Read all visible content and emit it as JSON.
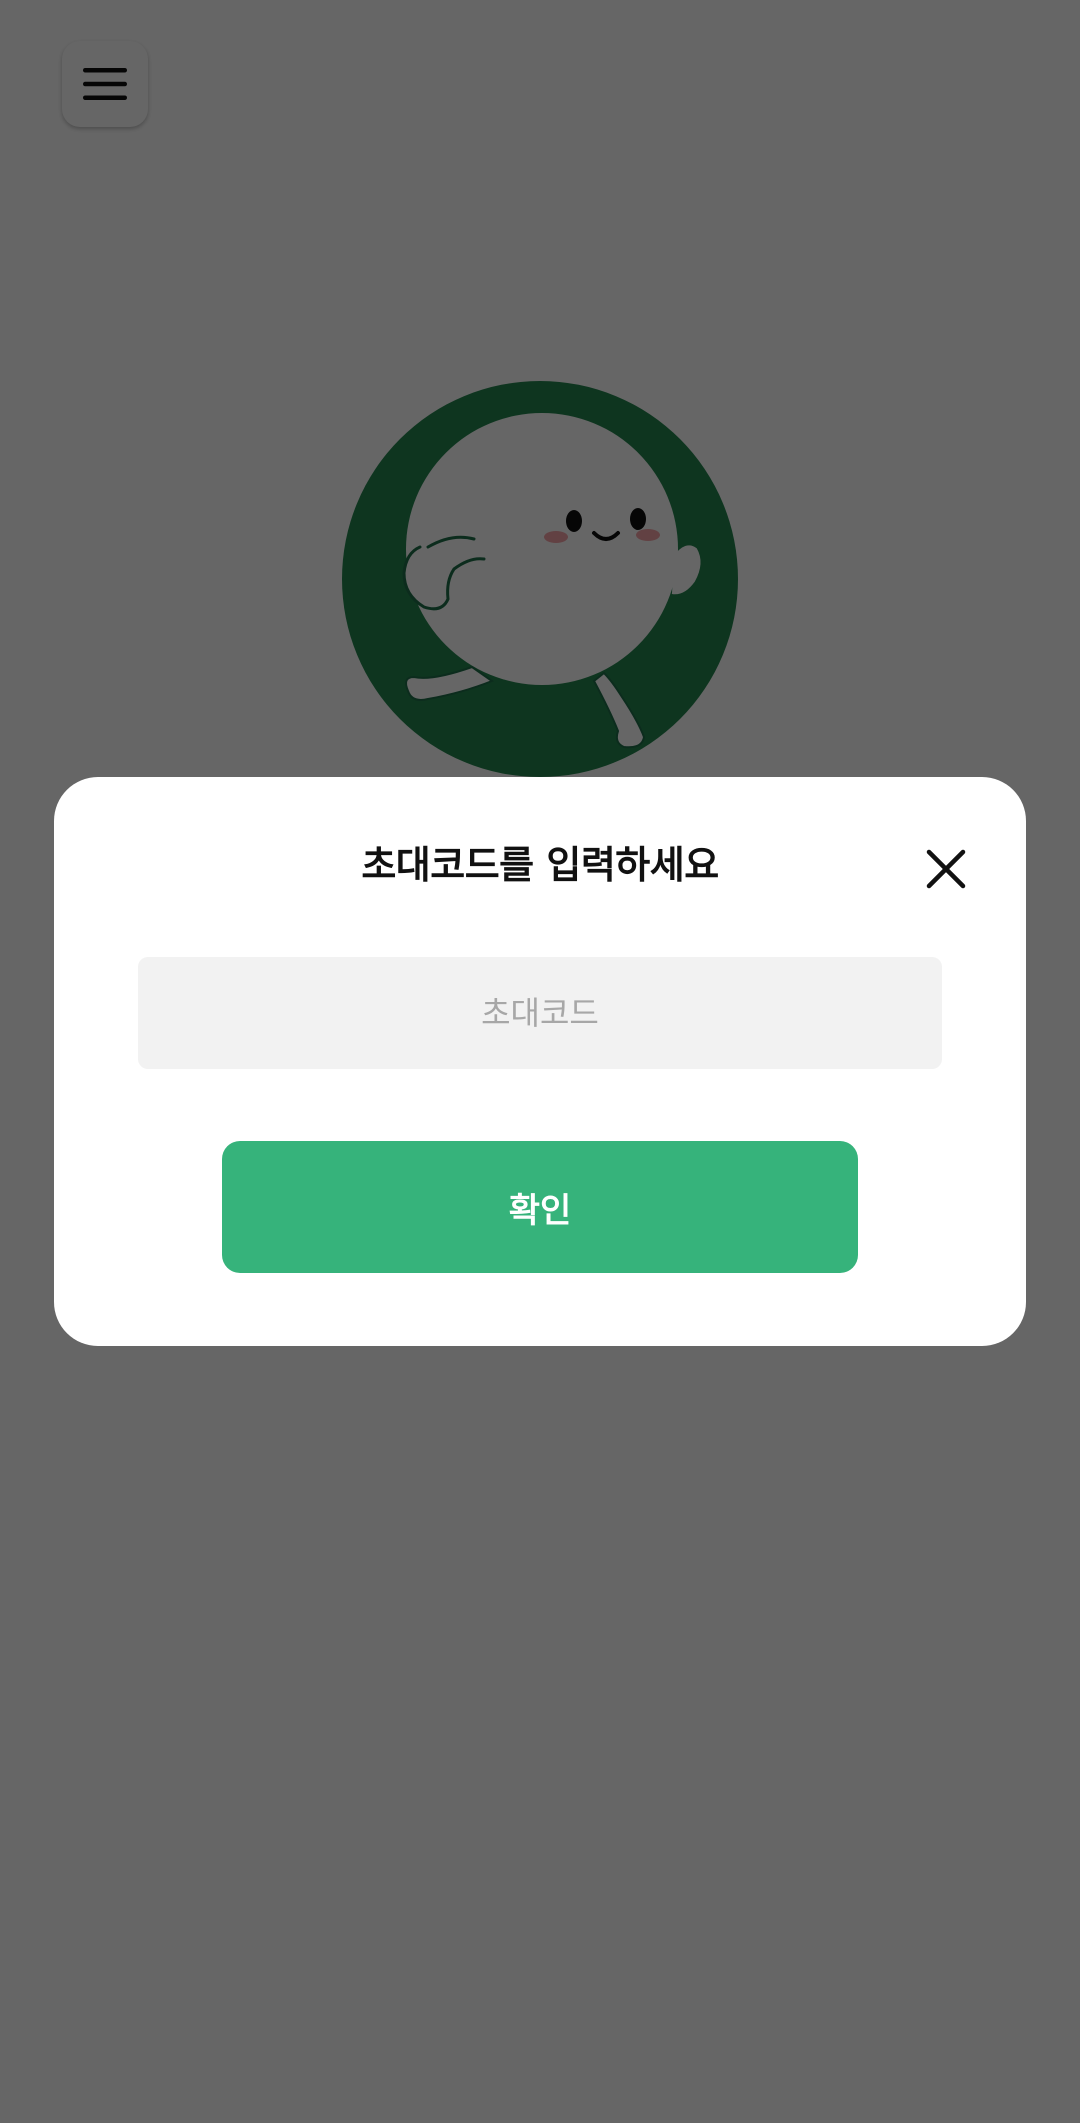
{
  "app": {
    "menu_icon": "hamburger-menu-icon",
    "mascot_icon": "running-mascot-logo",
    "brand_color": "#1f6f4a",
    "mascot_face_color": "#ffffff"
  },
  "modal": {
    "title": "초대코드를 입력하세요",
    "close_icon": "close-icon",
    "input": {
      "placeholder": "초대코드",
      "value": ""
    },
    "confirm_label": "확인",
    "confirm_color": "#36b37b"
  },
  "overlay_color": "rgba(0,0,0,0.6)"
}
